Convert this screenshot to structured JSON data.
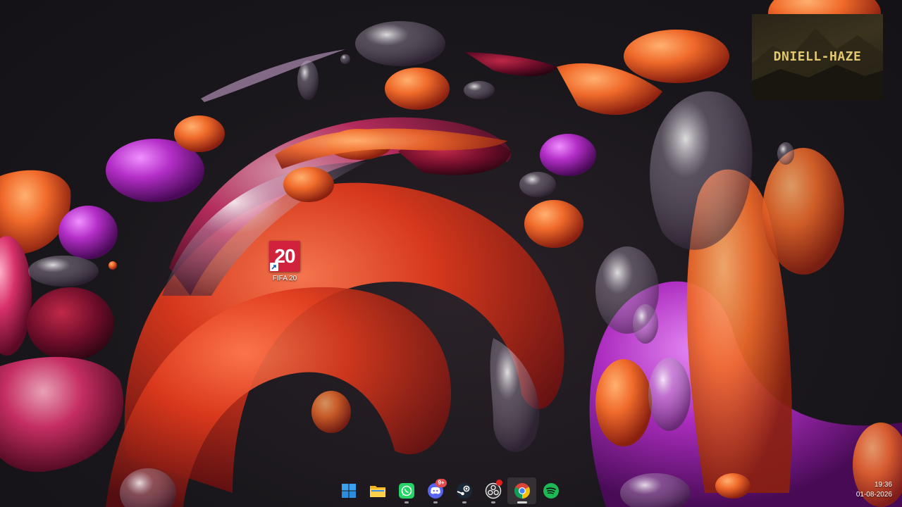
{
  "desktop": {
    "icons": [
      {
        "label": "FIFA 20",
        "tile_text": "20",
        "tile_color": "#d0223c",
        "icon": "fifa-20-shortcut-icon"
      }
    ]
  },
  "widget": {
    "text": "DNIELL-HAZE",
    "text_color": "#e3c870"
  },
  "taskbar": {
    "items": [
      {
        "name": "start",
        "icon": "windows-start-icon"
      },
      {
        "name": "file-explorer",
        "icon": "folder-icon"
      },
      {
        "name": "whatsapp",
        "icon": "whatsapp-icon"
      },
      {
        "name": "discord",
        "icon": "discord-icon",
        "badge": "9+"
      },
      {
        "name": "steam",
        "icon": "steam-icon"
      },
      {
        "name": "obs",
        "icon": "obs-icon",
        "notification": true
      },
      {
        "name": "chrome",
        "icon": "chrome-icon",
        "active": true
      },
      {
        "name": "spotify",
        "icon": "spotify-icon"
      }
    ],
    "clock": {
      "time": "19:36",
      "date": "01-08-2026"
    }
  },
  "colors": {
    "accent_red": "#d0223c",
    "whatsapp": "#25d366",
    "discord": "#5865f2",
    "spotify": "#1db954"
  }
}
